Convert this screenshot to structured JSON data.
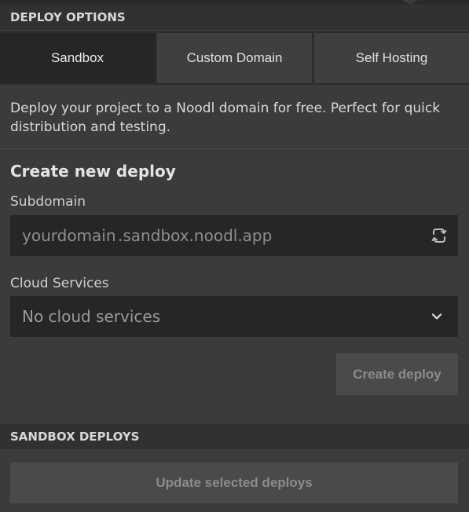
{
  "deploy_options": {
    "header": "DEPLOY OPTIONS",
    "tabs": [
      {
        "label": "Sandbox",
        "active": true
      },
      {
        "label": "Custom Domain",
        "active": false
      },
      {
        "label": "Self Hosting",
        "active": false
      }
    ],
    "description": "Deploy your project to a Noodl domain for free. Perfect for quick distribution and testing."
  },
  "create_deploy": {
    "title": "Create new deploy",
    "subdomain": {
      "label": "Subdomain",
      "placeholder": "yourdomain",
      "suffix": ".sandbox.noodl.app",
      "icon": "refresh-icon"
    },
    "cloud_services": {
      "label": "Cloud Services",
      "selected": "No cloud services",
      "icon": "chevron-down-icon"
    },
    "button_label": "Create deploy"
  },
  "sandbox_deploys": {
    "header": "SANDBOX DEPLOYS",
    "update_button_label": "Update selected deploys"
  },
  "colors": {
    "panel_bg": "#3b3b3b",
    "header_bg": "#313131",
    "input_bg": "#262626",
    "active_tab_bg": "#262626",
    "button_bg": "#4a4a4a",
    "button_text": "#8c8c8c"
  }
}
